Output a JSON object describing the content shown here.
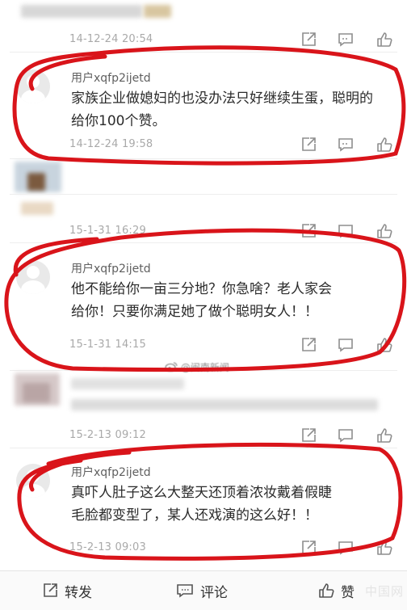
{
  "comments": [
    {
      "timestamp": "14-12-24 20:54"
    },
    {
      "username": "用户xqfp2ijetd",
      "text_lines": [
        "家族企业做媳妇的也没办法只好继续生蛋，聪明的",
        "给你100个赞。"
      ],
      "timestamp": "14-12-24 19:58"
    },
    {
      "timestamp": "15-1-31 16:29"
    },
    {
      "username": "用户xqfp2ijetd",
      "text_lines": [
        "他不能给你一亩三分地？你急啥？老人家会",
        "给你！只要你满足她了做个聪明女人！！"
      ],
      "timestamp": "15-1-31 14:15"
    },
    {
      "timestamp": "15-2-13 09:12"
    },
    {
      "username": "用户xqfp2ijetd",
      "text_lines": [
        "真吓人肚子这么大整天还顶着浓妆戴着假睫",
        "毛脸都变型了，某人还戏演的这么好！！"
      ],
      "timestamp": "15-2-13 09:03"
    }
  ],
  "watermark": "@闽南新闻",
  "bottom_bar": {
    "repost_label": "转发",
    "comment_label": "评论",
    "like_label": "赞"
  },
  "corner_mark": "中国网",
  "icons": {
    "repost": "repost-icon",
    "comment": "comment-icon",
    "like": "thumbs-up-icon",
    "avatar": "default-avatar-icon"
  },
  "colors": {
    "annotation_circle": "#d9141a",
    "timestamp": "#a9a9a9",
    "body_text": "#2b2b2b"
  }
}
